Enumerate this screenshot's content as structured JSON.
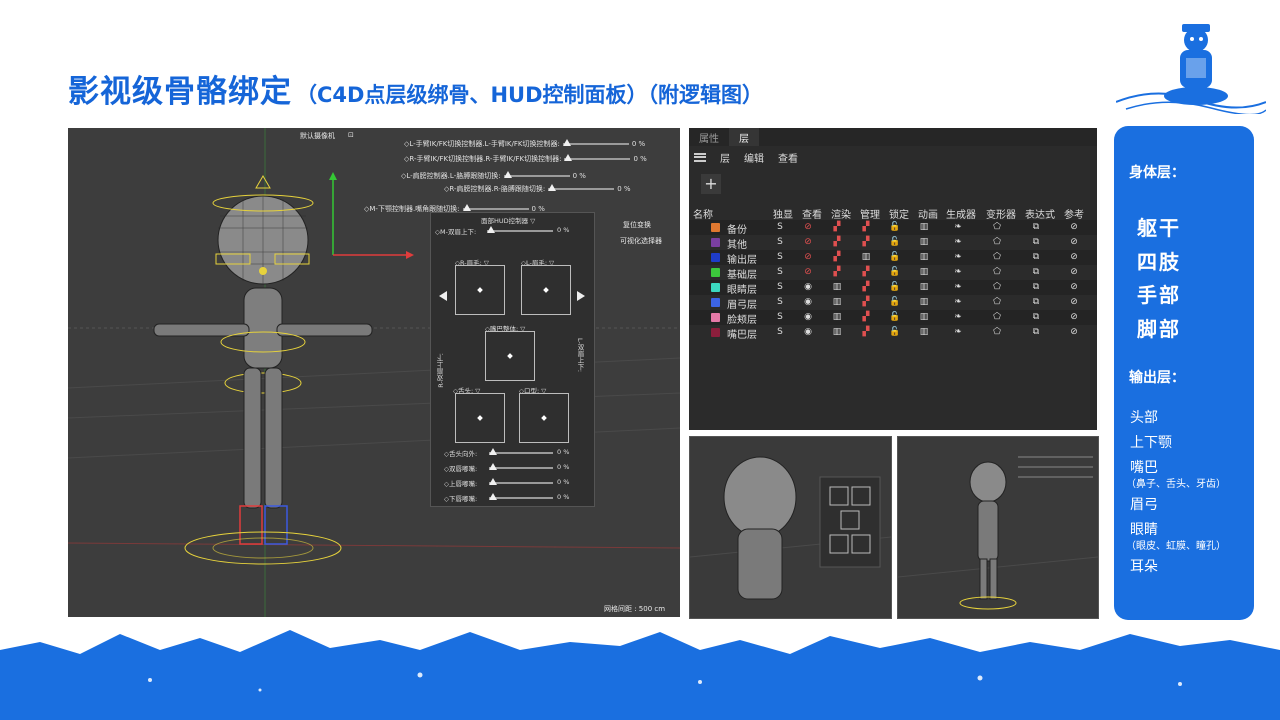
{
  "header": {
    "title_main": "影视级骨骼绑定",
    "title_sub": "（C4D点层级绑骨、HUD控制面板）（附逻辑图）"
  },
  "viewport": {
    "camera_label": "默认摄像机",
    "grid_label": "网格间距 : 500 cm",
    "controls": [
      {
        "label": "◇L-手臂IK/FK切换控制器.L-手臂IK/FK切换控制器:",
        "value": "0 %"
      },
      {
        "label": "◇R-手臂IK/FK切换控制器.R-手臂IK/FK切换控制器:",
        "value": "0 %"
      },
      {
        "label": "◇L-肩膀控制器.L-胳膊跟随切换:",
        "value": "0 %"
      },
      {
        "label": "◇R-肩膀控制器.R-胳膊跟随切换:",
        "value": "0 %"
      },
      {
        "label": "◇M-下颚控制器.嘴角跟随切换:",
        "value": "0 %"
      }
    ],
    "reset_label": "复位变换",
    "visual_select_label": "可视化选择器",
    "hud": {
      "title": "面部HUD控制器 ▽",
      "brow_updown": "◇M-双眉上下:",
      "brow_value": "0 %",
      "r_brow": "◇R-眉毛: ▽",
      "l_brow": "◇L-眉毛: ▽",
      "mouth_whole": "◇嘴巴整体: ▽",
      "r_brow_side": "R-双眉上下:",
      "l_brow_side": "L-双眉上下:",
      "side_value": "0 %",
      "tongue": "◇舌头: ▽",
      "mouth_shape": "◇口型: ▽",
      "sliders": [
        {
          "label": "◇舌头向外:",
          "value": "0 %"
        },
        {
          "label": "◇双唇嘟嘴:",
          "value": "0 %"
        },
        {
          "label": "◇上唇嘟嘴:",
          "value": "0 %"
        },
        {
          "label": "◇下唇嘟嘴:",
          "value": "0 %"
        }
      ]
    }
  },
  "layers_panel": {
    "tabs": [
      "属性",
      "层"
    ],
    "menu": [
      "层",
      "编辑",
      "查看"
    ],
    "add_label": "+",
    "columns": [
      "名称",
      "独显",
      "查看",
      "渲染",
      "管理",
      "锁定",
      "动画",
      "生成器",
      "变形器",
      "表达式",
      "参考"
    ],
    "rows": [
      {
        "name": "备份",
        "color": "#e07830"
      },
      {
        "name": "其他",
        "color": "#7a3fa0"
      },
      {
        "name": "输出层",
        "color": "#1e3cc8"
      },
      {
        "name": "基础层",
        "color": "#3cc83c"
      },
      {
        "name": "眼睛层",
        "color": "#3cd8c0"
      },
      {
        "name": "眉弓层",
        "color": "#3c64e6"
      },
      {
        "name": "脸颊层",
        "color": "#e67aa8"
      },
      {
        "name": "嘴巴层",
        "color": "#8c1e3c"
      }
    ],
    "icons": {
      "solo": "S",
      "view_on": "◉",
      "view_off": "⊘",
      "render": "▞",
      "lock": "🔓",
      "anim": "▥",
      "gen": "❧",
      "deform": "⬠",
      "expr": "⧉",
      "ref": "⊘"
    }
  },
  "side_panel": {
    "body_layer_title": "身体层：",
    "body_items": [
      "躯干",
      "四肢",
      "手部",
      "脚部"
    ],
    "output_layer_title": "输出层：",
    "output_items": [
      {
        "label": "头部",
        "note": ""
      },
      {
        "label": "上下颚",
        "note": ""
      },
      {
        "label": "嘴巴",
        "note": "（鼻子、舌头、牙齿）"
      },
      {
        "label": "眉弓",
        "note": ""
      },
      {
        "label": "眼睛",
        "note": "（眼皮、虹膜、瞳孔）"
      },
      {
        "label": "耳朵",
        "note": ""
      }
    ]
  },
  "colors": {
    "brand_blue": "#1565d8",
    "panel_blue": "#1a6fe0"
  }
}
